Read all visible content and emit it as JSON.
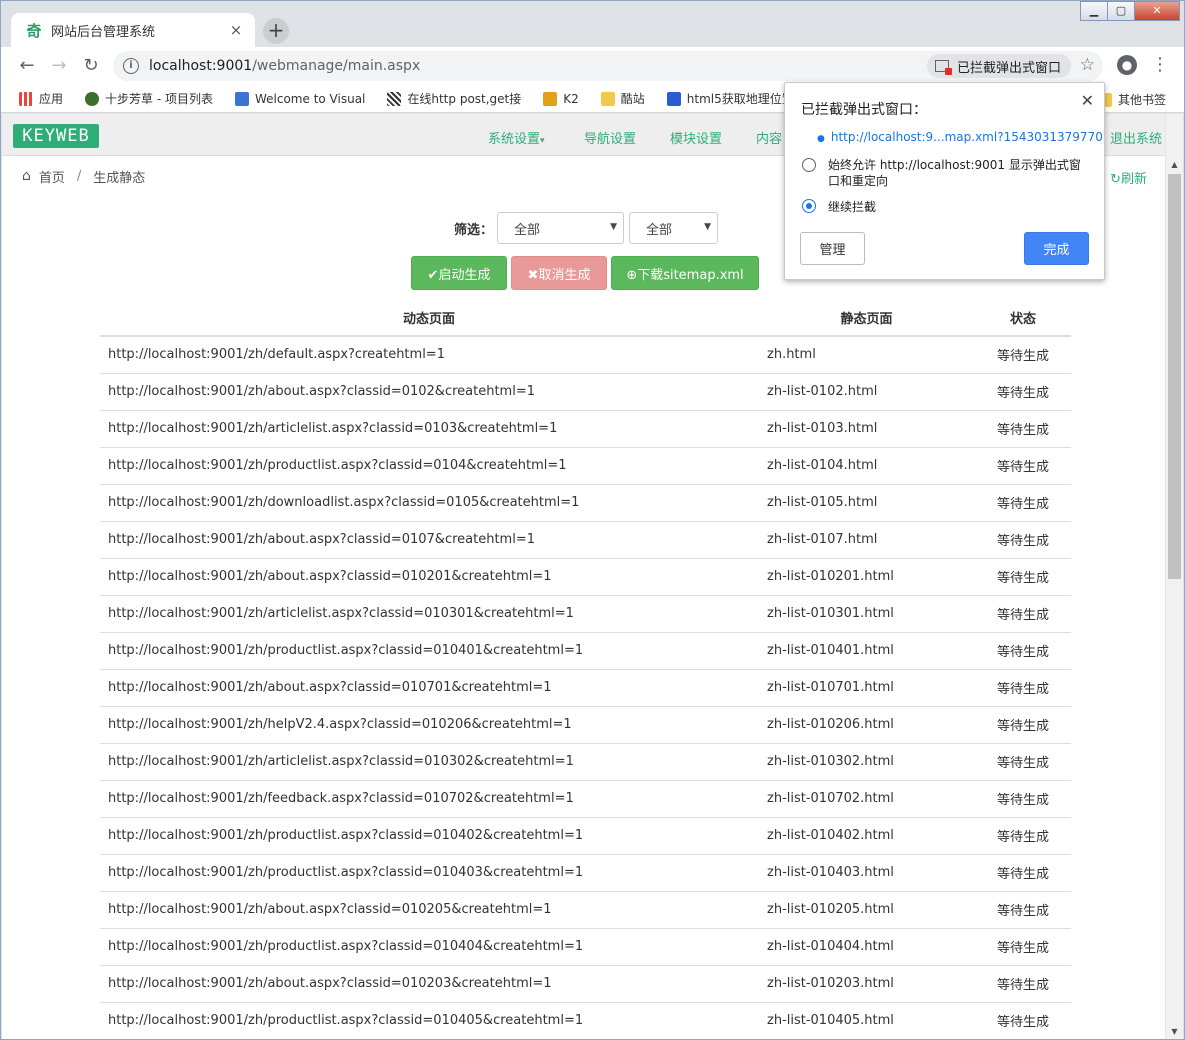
{
  "browser": {
    "tab_title": "网站后台管理系统",
    "tab_close": "×",
    "new_tab": "+",
    "url_host": "localhost:9001",
    "url_path": "/webmanage/main.aspx",
    "blocked_chip_label": "已拦截弹出式窗口",
    "window_controls": {
      "minimize": "▁",
      "maximize": "▢",
      "close": "✕"
    },
    "icons": {
      "back": "←",
      "forward": "→",
      "reload": "↻",
      "info": "i",
      "star": "☆",
      "profile": "●",
      "menu": "⋮"
    }
  },
  "bookmarks": {
    "items": [
      {
        "label": "应用",
        "color": "#e8453c"
      },
      {
        "label": "十步芳草 - 项目列表",
        "color": "#3c6e2f"
      },
      {
        "label": "Welcome to Visual",
        "color": "#3b73d1"
      },
      {
        "label": "在线http post,get接",
        "color": "#555555"
      },
      {
        "label": "K2",
        "color": "#e0a21a"
      },
      {
        "label": "酷站",
        "color": "#f2c94c"
      },
      {
        "label": "html5获取地理位置",
        "color": "#2a5bd7"
      }
    ],
    "other": "其他书签"
  },
  "site": {
    "logo": "KEYWEB",
    "nav": [
      {
        "label": "系统设置",
        "caret": "▾"
      },
      {
        "label": "导航设置"
      },
      {
        "label": "模块设置"
      },
      {
        "label": "内容"
      },
      {
        "label": "退出系统"
      }
    ],
    "breadcrumb": {
      "home": "首页",
      "sep": "/",
      "current": "生成静态"
    },
    "refresh": "↻刷新"
  },
  "filters": {
    "label": "筛选：",
    "select1": "全部",
    "select2": "全部",
    "arrow": "▼"
  },
  "actions": {
    "start": "✔启动生成",
    "cancel": "✖取消生成",
    "download": "⊕下载sitemap.xml"
  },
  "table": {
    "headers": [
      "动态页面",
      "静态页面",
      "状态"
    ],
    "rows": [
      [
        "http://localhost:9001/zh/default.aspx?createhtml=1",
        "zh.html",
        "等待生成"
      ],
      [
        "http://localhost:9001/zh/about.aspx?classid=0102&createhtml=1",
        "zh-list-0102.html",
        "等待生成"
      ],
      [
        "http://localhost:9001/zh/articlelist.aspx?classid=0103&createhtml=1",
        "zh-list-0103.html",
        "等待生成"
      ],
      [
        "http://localhost:9001/zh/productlist.aspx?classid=0104&createhtml=1",
        "zh-list-0104.html",
        "等待生成"
      ],
      [
        "http://localhost:9001/zh/downloadlist.aspx?classid=0105&createhtml=1",
        "zh-list-0105.html",
        "等待生成"
      ],
      [
        "http://localhost:9001/zh/about.aspx?classid=0107&createhtml=1",
        "zh-list-0107.html",
        "等待生成"
      ],
      [
        "http://localhost:9001/zh/about.aspx?classid=010201&createhtml=1",
        "zh-list-010201.html",
        "等待生成"
      ],
      [
        "http://localhost:9001/zh/articlelist.aspx?classid=010301&createhtml=1",
        "zh-list-010301.html",
        "等待生成"
      ],
      [
        "http://localhost:9001/zh/productlist.aspx?classid=010401&createhtml=1",
        "zh-list-010401.html",
        "等待生成"
      ],
      [
        "http://localhost:9001/zh/about.aspx?classid=010701&createhtml=1",
        "zh-list-010701.html",
        "等待生成"
      ],
      [
        "http://localhost:9001/zh/helpV2.4.aspx?classid=010206&createhtml=1",
        "zh-list-010206.html",
        "等待生成"
      ],
      [
        "http://localhost:9001/zh/articlelist.aspx?classid=010302&createhtml=1",
        "zh-list-010302.html",
        "等待生成"
      ],
      [
        "http://localhost:9001/zh/feedback.aspx?classid=010702&createhtml=1",
        "zh-list-010702.html",
        "等待生成"
      ],
      [
        "http://localhost:9001/zh/productlist.aspx?classid=010402&createhtml=1",
        "zh-list-010402.html",
        "等待生成"
      ],
      [
        "http://localhost:9001/zh/productlist.aspx?classid=010403&createhtml=1",
        "zh-list-010403.html",
        "等待生成"
      ],
      [
        "http://localhost:9001/zh/about.aspx?classid=010205&createhtml=1",
        "zh-list-010205.html",
        "等待生成"
      ],
      [
        "http://localhost:9001/zh/productlist.aspx?classid=010404&createhtml=1",
        "zh-list-010404.html",
        "等待生成"
      ],
      [
        "http://localhost:9001/zh/about.aspx?classid=010203&createhtml=1",
        "zh-list-010203.html",
        "等待生成"
      ],
      [
        "http://localhost:9001/zh/productlist.aspx?classid=010405&createhtml=1",
        "zh-list-010405.html",
        "等待生成"
      ]
    ]
  },
  "popup": {
    "title": "已拦截弹出式窗口：",
    "close": "✕",
    "link": "http://localhost:9...map.xml?1543031379770",
    "option_allow": "始终允许 http://localhost:9001 显示弹出式窗口和重定向",
    "option_block": "继续拦截",
    "manage": "管理",
    "done": "完成"
  },
  "colors": {
    "accent_green": "#2ead79",
    "button_green": "#5cb85c",
    "button_red_disabled": "#e99a98",
    "chrome_blue": "#4285f4"
  }
}
